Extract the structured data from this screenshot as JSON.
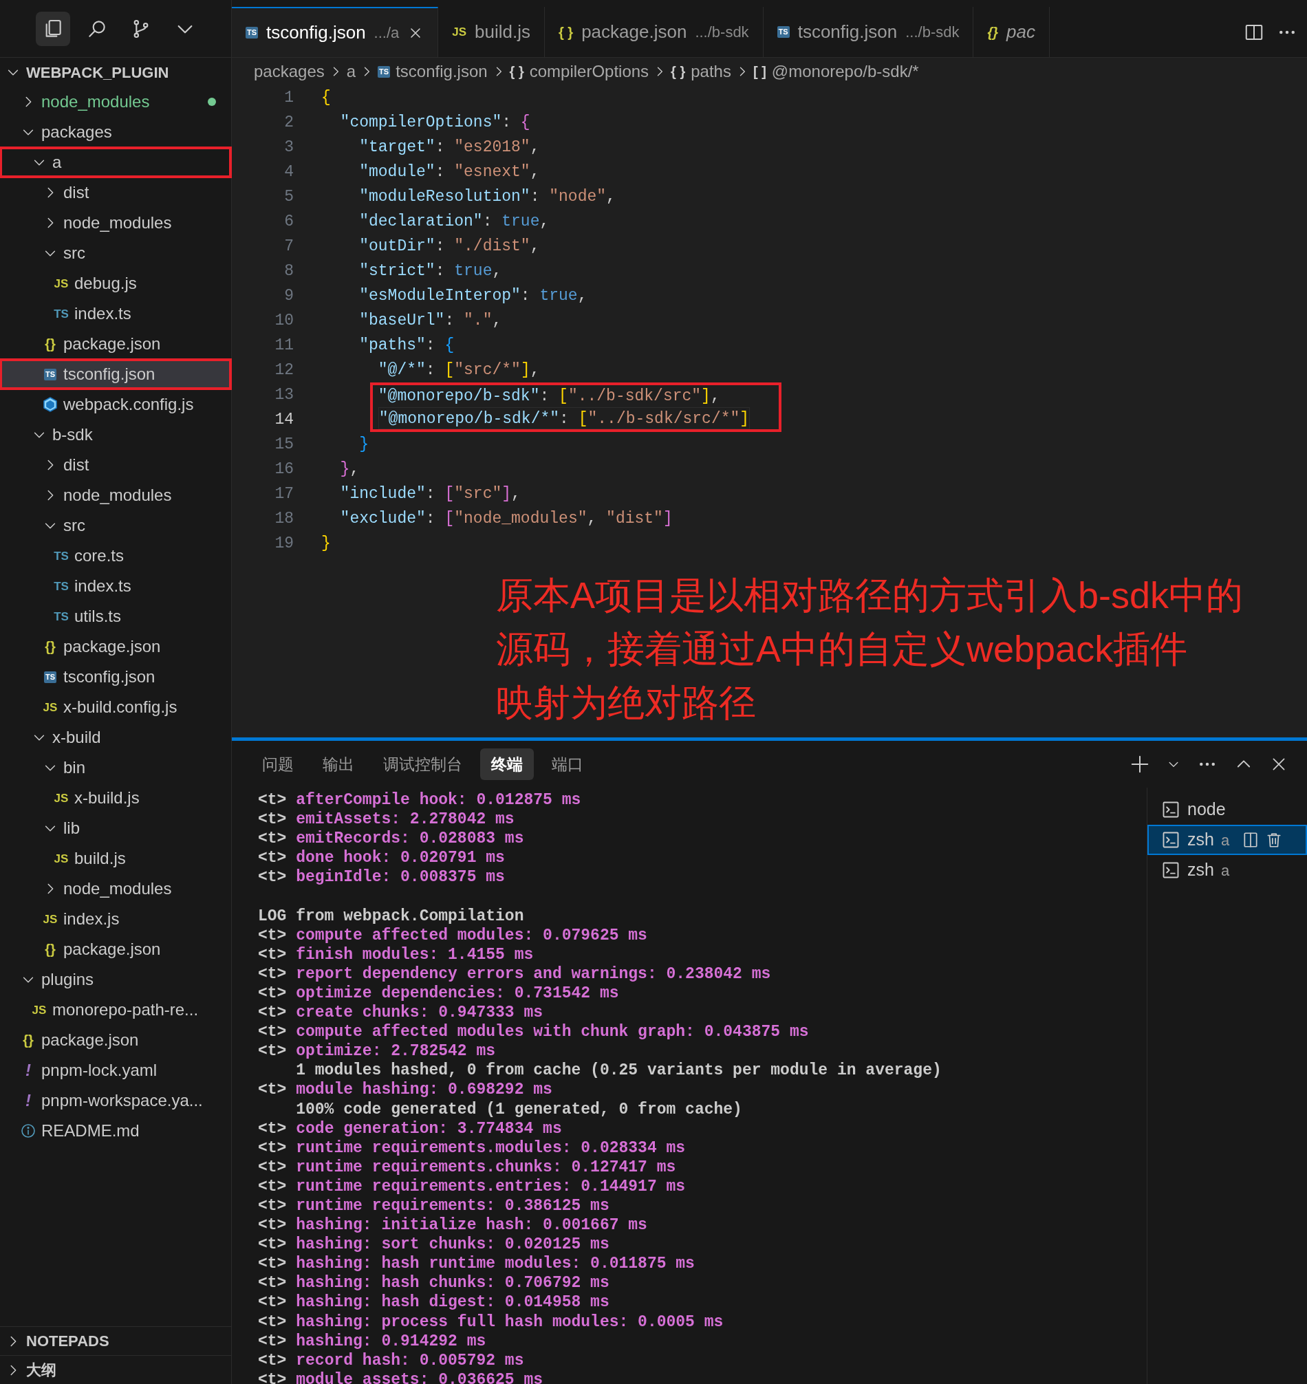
{
  "activity_icons": [
    {
      "kind": "explorer",
      "selected": true
    },
    {
      "kind": "search",
      "selected": false
    },
    {
      "kind": "source-control",
      "selected": false
    },
    {
      "kind": "more",
      "selected": false
    }
  ],
  "explorer": {
    "title": "WEBPACK_PLUGIN",
    "expanded": true,
    "tree": [
      {
        "label": "node_modules",
        "kind": "folder",
        "expanded": false,
        "selected": false,
        "highlighted": false,
        "untracked": true
      },
      {
        "label": "packages",
        "kind": "folder",
        "expanded": true,
        "selected": false,
        "highlighted": false,
        "untracked": false,
        "children": [
          {
            "label": "a",
            "kind": "folder",
            "expanded": true,
            "selected": false,
            "highlighted": true,
            "untracked": false,
            "children": [
              {
                "label": "dist",
                "kind": "folder",
                "expanded": false,
                "selected": false,
                "highlighted": false,
                "untracked": false
              },
              {
                "label": "node_modules",
                "kind": "folder",
                "expanded": false,
                "selected": false,
                "highlighted": false,
                "untracked": false
              },
              {
                "label": "src",
                "kind": "folder",
                "expanded": true,
                "selected": false,
                "highlighted": false,
                "untracked": false,
                "children": [
                  {
                    "label": "debug.js",
                    "kind": "js",
                    "icon": "JS",
                    "selected": false,
                    "highlighted": false,
                    "untracked": false
                  },
                  {
                    "label": "index.ts",
                    "kind": "ts",
                    "icon": "TS",
                    "selected": false,
                    "highlighted": false,
                    "untracked": false
                  }
                ]
              },
              {
                "label": "package.json",
                "kind": "json",
                "icon": "{}",
                "selected": false,
                "highlighted": false,
                "untracked": false
              },
              {
                "label": "tsconfig.json",
                "kind": "tsconfig",
                "icon": "TS",
                "selected": true,
                "highlighted": true,
                "untracked": false
              },
              {
                "label": "webpack.config.js",
                "kind": "webpack",
                "selected": false,
                "highlighted": false,
                "untracked": false
              }
            ]
          },
          {
            "label": "b-sdk",
            "kind": "folder",
            "expanded": true,
            "selected": false,
            "highlighted": false,
            "untracked": false,
            "children": [
              {
                "label": "dist",
                "kind": "folder",
                "expanded": false,
                "selected": false,
                "highlighted": false,
                "untracked": false
              },
              {
                "label": "node_modules",
                "kind": "folder",
                "expanded": false,
                "selected": false,
                "highlighted": false,
                "untracked": false
              },
              {
                "label": "src",
                "kind": "folder",
                "expanded": true,
                "selected": false,
                "highlighted": false,
                "untracked": false,
                "children": [
                  {
                    "label": "core.ts",
                    "kind": "ts",
                    "icon": "TS",
                    "selected": false,
                    "highlighted": false,
                    "untracked": false
                  },
                  {
                    "label": "index.ts",
                    "kind": "ts",
                    "icon": "TS",
                    "selected": false,
                    "highlighted": false,
                    "untracked": false
                  },
                  {
                    "label": "utils.ts",
                    "kind": "ts",
                    "icon": "TS",
                    "selected": false,
                    "highlighted": false,
                    "untracked": false
                  }
                ]
              },
              {
                "label": "package.json",
                "kind": "json",
                "icon": "{}",
                "selected": false,
                "highlighted": false,
                "untracked": false
              },
              {
                "label": "tsconfig.json",
                "kind": "tsconfig",
                "icon": "TS",
                "selected": false,
                "highlighted": false,
                "untracked": false
              },
              {
                "label": "x-build.config.js",
                "kind": "js",
                "icon": "JS",
                "selected": false,
                "highlighted": false,
                "untracked": false
              }
            ]
          },
          {
            "label": "x-build",
            "kind": "folder",
            "expanded": true,
            "selected": false,
            "highlighted": false,
            "untracked": false,
            "children": [
              {
                "label": "bin",
                "kind": "folder",
                "expanded": true,
                "selected": false,
                "highlighted": false,
                "untracked": false,
                "children": [
                  {
                    "label": "x-build.js",
                    "kind": "js",
                    "icon": "JS",
                    "selected": false,
                    "highlighted": false,
                    "untracked": false
                  }
                ]
              },
              {
                "label": "lib",
                "kind": "folder",
                "expanded": true,
                "selected": false,
                "highlighted": false,
                "untracked": false,
                "children": [
                  {
                    "label": "build.js",
                    "kind": "js",
                    "icon": "JS",
                    "selected": false,
                    "highlighted": false,
                    "untracked": false
                  }
                ]
              },
              {
                "label": "node_modules",
                "kind": "folder",
                "expanded": false,
                "selected": false,
                "highlighted": false,
                "untracked": false
              },
              {
                "label": "index.js",
                "kind": "js",
                "icon": "JS",
                "selected": false,
                "highlighted": false,
                "untracked": false
              },
              {
                "label": "package.json",
                "kind": "json",
                "icon": "{}",
                "selected": false,
                "highlighted": false,
                "untracked": false
              }
            ]
          }
        ]
      },
      {
        "label": "plugins",
        "kind": "folder",
        "expanded": true,
        "selected": false,
        "highlighted": false,
        "untracked": false,
        "children": [
          {
            "label": "monorepo-path-re...",
            "kind": "js",
            "icon": "JS",
            "selected": false,
            "highlighted": false,
            "untracked": false
          }
        ]
      },
      {
        "label": "package.json",
        "kind": "json",
        "icon": "{}",
        "selected": false,
        "highlighted": false,
        "untracked": false
      },
      {
        "label": "pnpm-lock.yaml",
        "kind": "yaml",
        "icon": "!",
        "selected": false,
        "highlighted": false,
        "untracked": false
      },
      {
        "label": "pnpm-workspace.ya...",
        "kind": "yaml",
        "icon": "!",
        "selected": false,
        "highlighted": false,
        "untracked": false
      },
      {
        "label": "README.md",
        "kind": "info",
        "selected": false,
        "highlighted": false,
        "untracked": false
      }
    ]
  },
  "sidebar_sections": [
    {
      "title": "NOTEPADS",
      "expanded": false
    },
    {
      "title": "大纲",
      "expanded": false
    }
  ],
  "tabs": [
    {
      "kind": "tsconfig",
      "icon": "TS",
      "label": "tsconfig.json",
      "description": ".../a",
      "selected": true,
      "preview": false
    },
    {
      "kind": "js",
      "icon": "JS",
      "label": "build.js",
      "selected": false,
      "preview": false
    },
    {
      "kind": "json",
      "icon": "{ }",
      "label": "package.json",
      "description": ".../b-sdk",
      "selected": false,
      "preview": false
    },
    {
      "kind": "tsconfig",
      "icon": "TS",
      "label": "tsconfig.json",
      "description": ".../b-sdk",
      "selected": false,
      "preview": false
    },
    {
      "kind": "json",
      "icon": "{}",
      "label": "pac",
      "selected": false,
      "preview": true
    }
  ],
  "breadcrumbs": [
    {
      "label": "packages"
    },
    {
      "label": "a"
    },
    {
      "kind": "tsconfig",
      "icon": "TS",
      "label": "tsconfig.json"
    },
    {
      "kind": "object",
      "icon": "{ }",
      "label": "compilerOptions"
    },
    {
      "kind": "object",
      "icon": "{ }",
      "label": "paths"
    },
    {
      "kind": "array",
      "icon": "[ ]",
      "label": "@monorepo/b-sdk/*"
    }
  ],
  "code_lines": [
    {
      "number": "1",
      "current": false,
      "highlighted": false,
      "tokens": [
        {
          "kind": "bracket1",
          "text": "{"
        }
      ],
      "children": [
        {
          "number": "2",
          "current": false,
          "highlighted": false,
          "tokens": [
            {
              "kind": "key",
              "text": "\"compilerOptions\""
            },
            {
              "kind": "punct",
              "text": ": "
            },
            {
              "kind": "bracket2",
              "text": "{"
            }
          ],
          "children": [
            {
              "number": "3",
              "current": false,
              "highlighted": false,
              "tokens": [
                {
                  "kind": "key",
                  "text": "\"target\""
                },
                {
                  "kind": "punct",
                  "text": ": "
                },
                {
                  "kind": "string",
                  "text": "\"es2018\""
                },
                {
                  "kind": "punct",
                  "text": ","
                }
              ]
            },
            {
              "number": "4",
              "current": false,
              "highlighted": false,
              "tokens": [
                {
                  "kind": "key",
                  "text": "\"module\""
                },
                {
                  "kind": "punct",
                  "text": ": "
                },
                {
                  "kind": "string",
                  "text": "\"esnext\""
                },
                {
                  "kind": "punct",
                  "text": ","
                }
              ]
            },
            {
              "number": "5",
              "current": false,
              "highlighted": false,
              "tokens": [
                {
                  "kind": "key",
                  "text": "\"moduleResolution\""
                },
                {
                  "kind": "punct",
                  "text": ": "
                },
                {
                  "kind": "string",
                  "text": "\"node\""
                },
                {
                  "kind": "punct",
                  "text": ","
                }
              ]
            },
            {
              "number": "6",
              "current": false,
              "highlighted": false,
              "tokens": [
                {
                  "kind": "key",
                  "text": "\"declaration\""
                },
                {
                  "kind": "punct",
                  "text": ": "
                },
                {
                  "kind": "bool",
                  "text": "true"
                },
                {
                  "kind": "punct",
                  "text": ","
                }
              ]
            },
            {
              "number": "7",
              "current": false,
              "highlighted": false,
              "tokens": [
                {
                  "kind": "key",
                  "text": "\"outDir\""
                },
                {
                  "kind": "punct",
                  "text": ": "
                },
                {
                  "kind": "string",
                  "text": "\"./dist\""
                },
                {
                  "kind": "punct",
                  "text": ","
                }
              ]
            },
            {
              "number": "8",
              "current": false,
              "highlighted": false,
              "tokens": [
                {
                  "kind": "key",
                  "text": "\"strict\""
                },
                {
                  "kind": "punct",
                  "text": ": "
                },
                {
                  "kind": "bool",
                  "text": "true"
                },
                {
                  "kind": "punct",
                  "text": ","
                }
              ]
            },
            {
              "number": "9",
              "current": false,
              "highlighted": false,
              "tokens": [
                {
                  "kind": "key",
                  "text": "\"esModuleInterop\""
                },
                {
                  "kind": "punct",
                  "text": ": "
                },
                {
                  "kind": "bool",
                  "text": "true"
                },
                {
                  "kind": "punct",
                  "text": ","
                }
              ]
            },
            {
              "number": "10",
              "current": false,
              "highlighted": false,
              "tokens": [
                {
                  "kind": "key",
                  "text": "\"baseUrl\""
                },
                {
                  "kind": "punct",
                  "text": ": "
                },
                {
                  "kind": "string",
                  "text": "\".\""
                },
                {
                  "kind": "punct",
                  "text": ","
                }
              ]
            },
            {
              "number": "11",
              "current": false,
              "highlighted": false,
              "tokens": [
                {
                  "kind": "key",
                  "text": "\"paths\""
                },
                {
                  "kind": "punct",
                  "text": ": "
                },
                {
                  "kind": "bracket3",
                  "text": "{"
                }
              ],
              "children": [
                {
                  "number": "12",
                  "current": false,
                  "highlighted": false,
                  "tokens": [
                    {
                      "kind": "key",
                      "text": "\"@/*\""
                    },
                    {
                      "kind": "punct",
                      "text": ": "
                    },
                    {
                      "kind": "bracket1",
                      "text": "["
                    },
                    {
                      "kind": "string",
                      "text": "\"src/*\""
                    },
                    {
                      "kind": "bracket1",
                      "text": "]"
                    },
                    {
                      "kind": "punct",
                      "text": ","
                    }
                  ]
                },
                {
                  "number": "13",
                  "current": false,
                  "highlighted": true,
                  "tokens": [
                    {
                      "kind": "key",
                      "text": "\"@monorepo/b-sdk\""
                    },
                    {
                      "kind": "punct",
                      "text": ": "
                    },
                    {
                      "kind": "bracket1",
                      "text": "["
                    },
                    {
                      "kind": "string",
                      "text": "\"../b-sdk/src\""
                    },
                    {
                      "kind": "bracket1",
                      "text": "]"
                    },
                    {
                      "kind": "punct",
                      "text": ","
                    }
                  ]
                },
                {
                  "number": "14",
                  "current": true,
                  "highlighted": true,
                  "tokens": [
                    {
                      "kind": "key",
                      "text": "\"@monorepo/b-sdk/*\""
                    },
                    {
                      "kind": "punct",
                      "text": ": "
                    },
                    {
                      "kind": "bracket1",
                      "text": "["
                    },
                    {
                      "kind": "string",
                      "text": "\"../b-sdk/src/*\""
                    },
                    {
                      "kind": "bracket1",
                      "text": "]"
                    }
                  ]
                }
              ]
            },
            {
              "number": "15",
              "current": false,
              "highlighted": false,
              "tokens": [
                {
                  "kind": "bracket3",
                  "text": "}"
                }
              ]
            }
          ]
        },
        {
          "number": "16",
          "current": false,
          "highlighted": false,
          "tokens": [
            {
              "kind": "bracket2",
              "text": "}"
            },
            {
              "kind": "punct",
              "text": ","
            }
          ]
        },
        {
          "number": "17",
          "current": false,
          "highlighted": false,
          "tokens": [
            {
              "kind": "key",
              "text": "\"include\""
            },
            {
              "kind": "punct",
              "text": ": "
            },
            {
              "kind": "bracket2",
              "text": "["
            },
            {
              "kind": "string",
              "text": "\"src\""
            },
            {
              "kind": "bracket2",
              "text": "]"
            },
            {
              "kind": "punct",
              "text": ","
            }
          ]
        },
        {
          "number": "18",
          "current": false,
          "highlighted": false,
          "tokens": [
            {
              "kind": "key",
              "text": "\"exclude\""
            },
            {
              "kind": "punct",
              "text": ": "
            },
            {
              "kind": "bracket2",
              "text": "["
            },
            {
              "kind": "string",
              "text": "\"node_modules\""
            },
            {
              "kind": "punct",
              "text": ", "
            },
            {
              "kind": "string",
              "text": "\"dist\""
            },
            {
              "kind": "bracket2",
              "text": "]"
            }
          ]
        }
      ]
    },
    {
      "number": "19",
      "current": false,
      "highlighted": false,
      "tokens": [
        {
          "kind": "bracket1",
          "text": "}"
        }
      ]
    }
  ],
  "annotation": {
    "lines": [
      "原本A项目是以相对路径的方式引入b-sdk中的",
      "源码，接着通过A中的自定义webpack插件",
      "映射为绝对路径"
    ]
  },
  "panel": {
    "tabs": [
      {
        "label": "问题",
        "selected": false
      },
      {
        "label": "输出",
        "selected": false
      },
      {
        "label": "调试控制台",
        "selected": false
      },
      {
        "label": "终端",
        "selected": true
      },
      {
        "label": "端口",
        "selected": false
      }
    ],
    "terminal_lines": [
      {
        "kind": "timing",
        "prefix": "<t>",
        "text": "afterCompile hook: 0.012875 ms"
      },
      {
        "kind": "timing",
        "prefix": "<t>",
        "text": "emitAssets: 2.278042 ms"
      },
      {
        "kind": "timing",
        "prefix": "<t>",
        "text": "emitRecords: 0.028083 ms"
      },
      {
        "kind": "timing",
        "prefix": "<t>",
        "text": "done hook: 0.020791 ms"
      },
      {
        "kind": "timing",
        "prefix": "<t>",
        "text": "beginIdle: 0.008375 ms"
      },
      {
        "kind": "blank"
      },
      {
        "kind": "heading",
        "text": "LOG from webpack.Compilation"
      },
      {
        "kind": "timing",
        "prefix": "<t>",
        "text": "compute affected modules: 0.079625 ms"
      },
      {
        "kind": "timing",
        "prefix": "<t>",
        "text": "finish modules: 1.4155 ms"
      },
      {
        "kind": "timing",
        "prefix": "<t>",
        "text": "report dependency errors and warnings: 0.238042 ms"
      },
      {
        "kind": "timing",
        "prefix": "<t>",
        "text": "optimize dependencies: 0.731542 ms"
      },
      {
        "kind": "timing",
        "prefix": "<t>",
        "text": "create chunks: 0.947333 ms"
      },
      {
        "kind": "timing",
        "prefix": "<t>",
        "text": "compute affected modules with chunk graph: 0.043875 ms"
      },
      {
        "kind": "timing",
        "prefix": "<t>",
        "text": "optimize: 2.782542 ms"
      },
      {
        "kind": "detail",
        "text": "1 modules hashed, 0 from cache (0.25 variants per module in average)"
      },
      {
        "kind": "timing",
        "prefix": "<t>",
        "text": "module hashing: 0.698292 ms"
      },
      {
        "kind": "detail",
        "text": "100% code generated (1 generated, 0 from cache)"
      },
      {
        "kind": "timing",
        "prefix": "<t>",
        "text": "code generation: 3.774834 ms"
      },
      {
        "kind": "timing",
        "prefix": "<t>",
        "text": "runtime requirements.modules: 0.028334 ms"
      },
      {
        "kind": "timing",
        "prefix": "<t>",
        "text": "runtime requirements.chunks: 0.127417 ms"
      },
      {
        "kind": "timing",
        "prefix": "<t>",
        "text": "runtime requirements.entries: 0.144917 ms"
      },
      {
        "kind": "timing",
        "prefix": "<t>",
        "text": "runtime requirements: 0.386125 ms"
      },
      {
        "kind": "timing",
        "prefix": "<t>",
        "text": "hashing: initialize hash: 0.001667 ms"
      },
      {
        "kind": "timing",
        "prefix": "<t>",
        "text": "hashing: sort chunks: 0.020125 ms"
      },
      {
        "kind": "timing",
        "prefix": "<t>",
        "text": "hashing: hash runtime modules: 0.011875 ms"
      },
      {
        "kind": "timing",
        "prefix": "<t>",
        "text": "hashing: hash chunks: 0.706792 ms"
      },
      {
        "kind": "timing",
        "prefix": "<t>",
        "text": "hashing: hash digest: 0.014958 ms"
      },
      {
        "kind": "timing",
        "prefix": "<t>",
        "text": "hashing: process full hash modules: 0.0005 ms"
      },
      {
        "kind": "timing",
        "prefix": "<t>",
        "text": "hashing: 0.914292 ms"
      },
      {
        "kind": "timing",
        "prefix": "<t>",
        "text": "record hash: 0.005792 ms"
      },
      {
        "kind": "timing",
        "prefix": "<t>",
        "text": "module assets: 0.036625 ms"
      }
    ],
    "terminals": [
      {
        "label": "node",
        "selected": false
      },
      {
        "label": "zsh",
        "sublabel": "a",
        "selected": true
      },
      {
        "label": "zsh",
        "sublabel": "a",
        "selected": false
      }
    ]
  }
}
